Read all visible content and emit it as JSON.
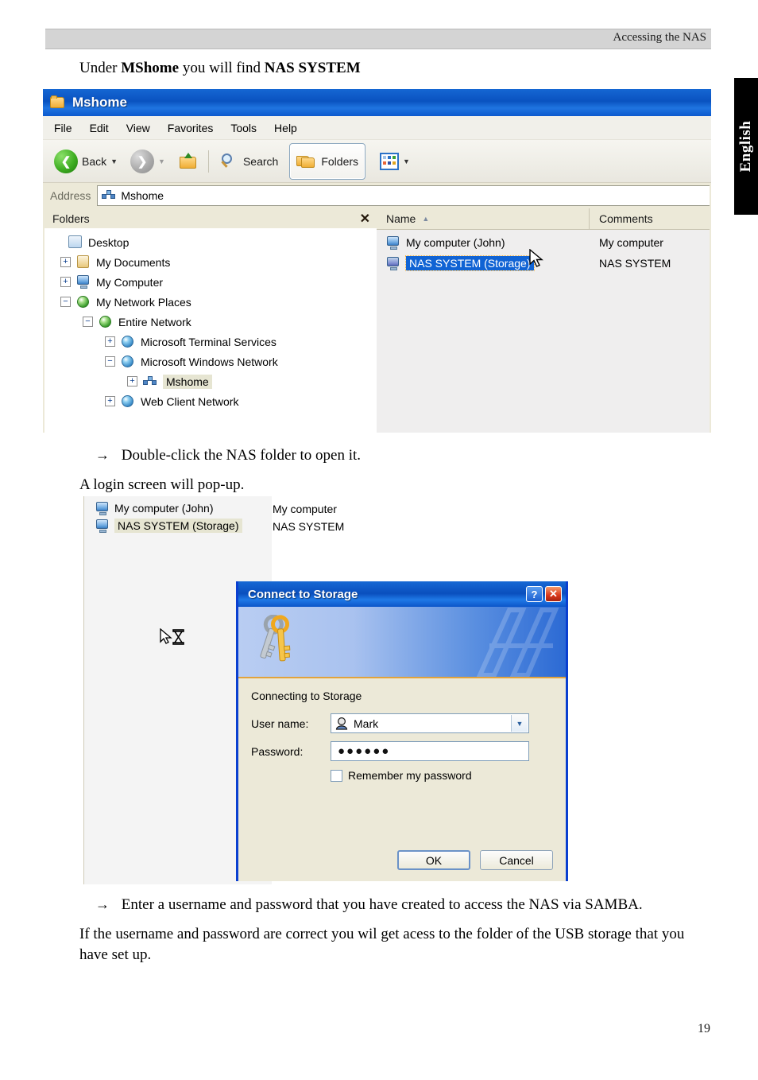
{
  "page": {
    "header_text": "Accessing the NAS",
    "side_tab_label": "English",
    "page_number": "19"
  },
  "prose": {
    "intro_pre": "Under ",
    "intro_bold1": "MShome",
    "intro_mid": " you will find ",
    "intro_bold2": "NAS SYSTEM",
    "step1_arrow": "→",
    "step1_text": "Double-click the NAS folder to open it.",
    "login_note": "A login screen will pop-up.",
    "step2_arrow": "→",
    "step2_text": "Enter a username and password that you have created to access the NAS via SAMBA.",
    "closing": "If the username and password are correct you wil get acess to the folder of the USB storage that you have set up."
  },
  "explorer": {
    "title": "Mshome",
    "title_icon": "folder-open-icon",
    "menu": [
      "File",
      "Edit",
      "View",
      "Favorites",
      "Tools",
      "Help"
    ],
    "toolbar": {
      "back_label": "Back",
      "back_icon": "back-arrow-icon",
      "back_dropdown_icon": "caret-down-icon",
      "forward_icon": "forward-arrow-icon",
      "forward_dropdown_icon": "caret-down-icon",
      "up_icon": "up-folder-icon",
      "search_label": "Search",
      "search_icon": "magnifier-icon",
      "folders_label": "Folders",
      "folders_icon": "folders-icon",
      "views_icon": "views-icon",
      "views_dropdown_icon": "caret-down-icon"
    },
    "address": {
      "label": "Address",
      "value": "Mshome",
      "icon": "workgroup-icon"
    },
    "tree": {
      "header": "Folders",
      "close_icon": "✕",
      "nodes": [
        {
          "label": "Desktop",
          "indent": 0,
          "expander": "",
          "icon": "desktop-icon",
          "selected": false
        },
        {
          "label": "My Documents",
          "indent": 1,
          "expander": "+",
          "icon": "documents-icon",
          "selected": false
        },
        {
          "label": "My Computer",
          "indent": 1,
          "expander": "+",
          "icon": "computer-icon",
          "selected": false
        },
        {
          "label": "My Network Places",
          "indent": 1,
          "expander": "−",
          "icon": "network-places-icon",
          "selected": false
        },
        {
          "label": "Entire Network",
          "indent": 2,
          "expander": "−",
          "icon": "globe-icon",
          "selected": false
        },
        {
          "label": "Microsoft Terminal Services",
          "indent": 3,
          "expander": "+",
          "icon": "globe-icon",
          "selected": false
        },
        {
          "label": "Microsoft Windows Network",
          "indent": 3,
          "expander": "−",
          "icon": "globe-icon",
          "selected": false
        },
        {
          "label": "Mshome",
          "indent": 4,
          "expander": "+",
          "icon": "workgroup-icon",
          "selected": true
        },
        {
          "label": "Web Client Network",
          "indent": 3,
          "expander": "+",
          "icon": "globe-icon",
          "selected": false
        }
      ]
    },
    "list": {
      "columns": [
        "Name",
        "Comments"
      ],
      "sort_column": "Name",
      "sort_arrow": "▲",
      "rows": [
        {
          "name": "My computer (John)",
          "comments": "My computer",
          "icon": "computer-icon",
          "selected": false
        },
        {
          "name": "NAS SYSTEM (Storage)",
          "comments": "NAS SYSTEM",
          "icon": "computer-icon",
          "selected": true
        }
      ],
      "cursor_icon": "arrow-cursor-icon"
    }
  },
  "login_shot": {
    "list_rows": [
      {
        "name": "My computer (John)",
        "comments": "My computer",
        "icon": "computer-icon",
        "highlighted": false
      },
      {
        "name": "NAS SYSTEM (Storage)",
        "comments": "NAS SYSTEM",
        "icon": "computer-icon",
        "highlighted": true
      }
    ],
    "busy_cursor_icon": "busy-cursor-icon",
    "dialog": {
      "title": "Connect to Storage",
      "help_button": "?",
      "close_button": "✕",
      "banner_icon": "keys-icon",
      "subtitle": "Connecting to Storage",
      "username_label": "User name:",
      "username_value": "Mark",
      "username_icon": "user-icon",
      "username_dropdown_icon": "chevron-down-icon",
      "password_label": "Password:",
      "password_value": "●●●●●●",
      "remember_label": "Remember my password",
      "remember_checked": false,
      "ok_label": "OK",
      "cancel_label": "Cancel"
    }
  },
  "colors": {
    "title_blue": "#0a52c0",
    "selection_blue": "#1063d4",
    "dialog_face": "#ece9d8",
    "banner_orange": "#e2a33c",
    "header_band": "#d4d4d4"
  }
}
